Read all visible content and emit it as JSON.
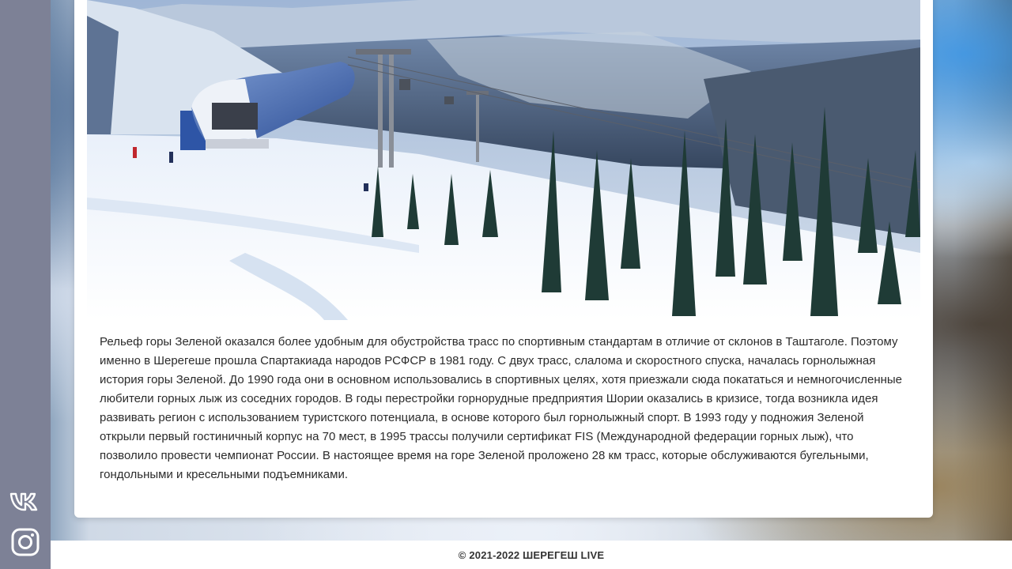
{
  "sidebar": {
    "links": [
      {
        "icon": "vk-icon",
        "label": "VK"
      },
      {
        "icon": "instagram-icon",
        "label": "Instagram"
      }
    ],
    "color": "#7d8196"
  },
  "article": {
    "photo_icon": "mountain-photo",
    "text": "Рельеф горы Зеленой оказался более удобным для обустройства трасс по спортивным стандартам в отличие от склонов в Таштаголе. Поэтому именно в Шерегеше прошла Спартакиада народов РСФСР в 1981 году. С двух трасс, слалома и скоростного спуска, началась горнолыжная история горы Зеленой. До 1990 года они в основном использовались в спортивных целях, хотя приезжали сюда покататься и немногочисленные любители горных лыж из соседних городов. В годы перестройки горнорудные предприятия Шории оказались в кризисе, тогда возникла идея развивать регион с использованием туристского потенциала, в основе которого был горнолыжный спорт. В 1993 году у подножия Зеленой открыли первый гостиничный корпус на 70 мест, в 1995 трассы получили сертификат FIS (Международной федерации горных лыж), что позволило провести чемпионат России. В настоящее время на горе Зеленой проложено 28 км трасс, которые обслуживаются бугельными, гондольными и кресельными подъемниками."
  },
  "footer": {
    "copyright": "© 2021-2022 ШЕРЕГЕШ LIVE"
  }
}
